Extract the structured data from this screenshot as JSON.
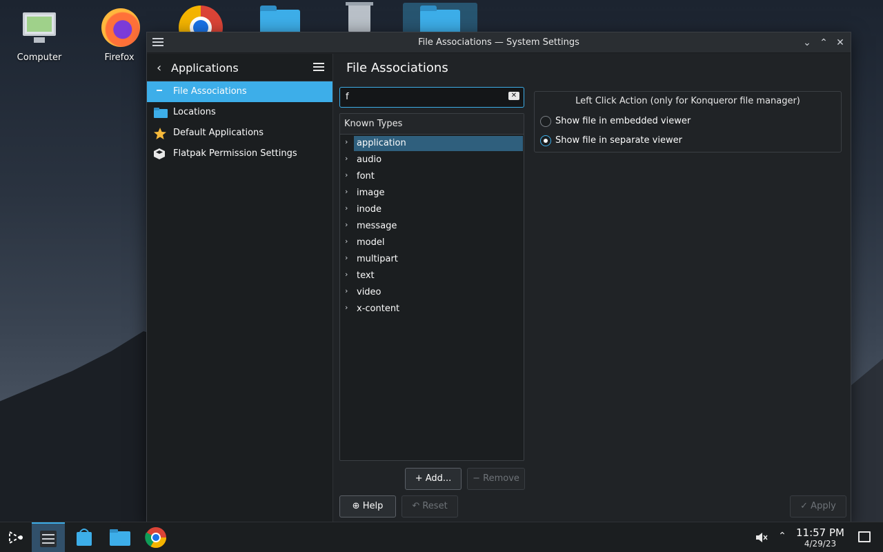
{
  "desktop": {
    "icons": [
      {
        "label": "Computer",
        "icon": "computer-icon"
      },
      {
        "label": "Firefox",
        "icon": "firefox-icon"
      },
      {
        "label": "",
        "icon": "chrome-icon"
      },
      {
        "label": "",
        "icon": "folder-icon"
      },
      {
        "label": "",
        "icon": "trash-icon"
      },
      {
        "label": "",
        "icon": "home-folder-icon"
      }
    ]
  },
  "window": {
    "title": "File Associations — System Settings"
  },
  "sidebar": {
    "back_title": "Applications",
    "items": [
      {
        "label": "File Associations",
        "icon": "file-associations-icon",
        "active": true
      },
      {
        "label": "Locations",
        "icon": "folder-icon",
        "active": false
      },
      {
        "label": "Default Applications",
        "icon": "star-icon",
        "active": false
      },
      {
        "label": "Flatpak Permission Settings",
        "icon": "flatpak-icon",
        "active": false
      }
    ]
  },
  "main": {
    "title": "File Associations",
    "search": {
      "value": "f"
    },
    "tree": {
      "header": "Known Types",
      "rows": [
        "application",
        "audio",
        "font",
        "image",
        "inode",
        "message",
        "model",
        "multipart",
        "text",
        "video",
        "x-content"
      ],
      "selected": "application"
    },
    "add_label": "Add...",
    "remove_label": "Remove",
    "group": {
      "title": "Left Click Action (only for Konqueror file manager)",
      "options": [
        {
          "label": "Show file in embedded viewer",
          "checked": false
        },
        {
          "label": "Show file in separate viewer",
          "checked": true
        }
      ]
    },
    "help_label": "Help",
    "reset_label": "Reset",
    "apply_label": "Apply"
  },
  "taskbar": {
    "time": "11:57 PM",
    "date": "4/29/23"
  },
  "colors": {
    "accent": "#3daee9",
    "window_bg": "#202326",
    "sidebar_bg": "#1b1e20"
  }
}
